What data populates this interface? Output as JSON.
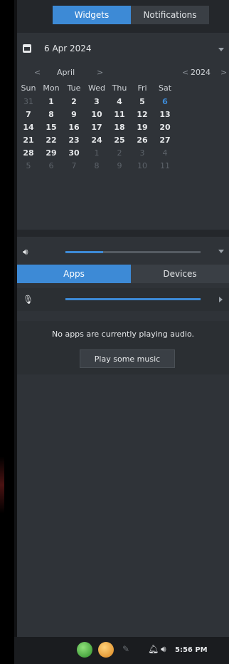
{
  "tabs": {
    "widgets": "Widgets",
    "notifications": "Notifications"
  },
  "calendar": {
    "selected_date": "6 Apr 2024",
    "month": "April",
    "year": "2024",
    "prev_month": "<",
    "next_month": ">",
    "prev_year": "<",
    "next_year": ">",
    "weekdays": [
      "Sun",
      "Mon",
      "Tue",
      "Wed",
      "Thu",
      "Fri",
      "Sat"
    ],
    "weeks": [
      [
        "31",
        "1",
        "2",
        "3",
        "4",
        "5",
        "6"
      ],
      [
        "7",
        "8",
        "9",
        "10",
        "11",
        "12",
        "13"
      ],
      [
        "14",
        "15",
        "16",
        "17",
        "18",
        "19",
        "20"
      ],
      [
        "21",
        "22",
        "23",
        "24",
        "25",
        "26",
        "27"
      ],
      [
        "28",
        "29",
        "30",
        "1",
        "2",
        "3",
        "4"
      ],
      [
        "5",
        "6",
        "7",
        "8",
        "9",
        "10",
        "11"
      ]
    ],
    "today": "6"
  },
  "volume": {
    "level": 0.28,
    "mic_level": 1.0
  },
  "audio_tabs": {
    "apps": "Apps",
    "devices": "Devices"
  },
  "audio": {
    "empty_text": "No apps are currently playing audio.",
    "play_button": "Play some music"
  },
  "taskbar": {
    "clock": "5:56 PM"
  },
  "colors": {
    "accent": "#3d8ad6",
    "panel": "#2f3338"
  }
}
